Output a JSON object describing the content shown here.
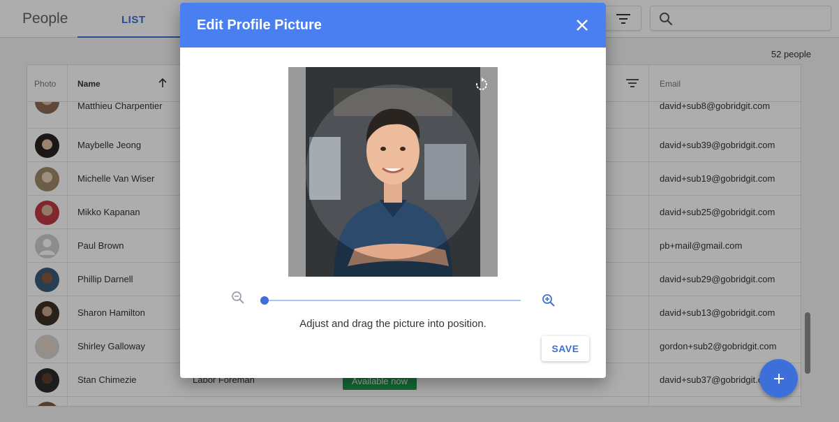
{
  "app": {
    "title": "People",
    "tab_list": "LIST"
  },
  "search": {
    "value": "",
    "placeholder": ""
  },
  "people_count": "52 people",
  "table": {
    "headers": {
      "photo": "Photo",
      "name": "Name",
      "email": "Email"
    },
    "rows": [
      {
        "name": "Matthieu Charpentier",
        "email": "david+sub8@gobridgit.com",
        "role": "",
        "status": ""
      },
      {
        "name": "Maybelle Jeong",
        "email": "david+sub39@gobridgit.com",
        "role": "",
        "status": ""
      },
      {
        "name": "Michelle Van Wiser",
        "email": "david+sub19@gobridgit.com",
        "role": "",
        "status": ""
      },
      {
        "name": "Mikko Kapanan",
        "email": "david+sub25@gobridgit.com",
        "role": "",
        "status": ""
      },
      {
        "name": "Paul Brown",
        "email": "pb+mail@gmail.com",
        "role": "",
        "status": ""
      },
      {
        "name": "Phillip Darnell",
        "email": "david+sub29@gobridgit.com",
        "role": "",
        "status": ""
      },
      {
        "name": "Sharon Hamilton",
        "email": "david+sub13@gobridgit.com",
        "role": "",
        "status": ""
      },
      {
        "name": "Shirley Galloway",
        "email": "gordon+sub2@gobridgit.com",
        "role": "",
        "status": ""
      },
      {
        "name": "Stan Chimezie",
        "email": "david+sub37@gobridgit.com",
        "role": "Labor Foreman",
        "status": "Available now"
      }
    ]
  },
  "dialog": {
    "title": "Edit Profile Picture",
    "hint": "Adjust and drag the picture into position.",
    "save_label": "SAVE",
    "zoom_level": 0
  },
  "colors": {
    "accent": "#4a7ff2",
    "primary": "#3b6fd8",
    "status_green": "#1e9e4d"
  },
  "icons": [
    "filter-icon",
    "search-icon",
    "sort-arrow-up-icon",
    "close-icon",
    "rotate-icon",
    "zoom-out-icon",
    "zoom-in-icon",
    "plus-icon"
  ]
}
